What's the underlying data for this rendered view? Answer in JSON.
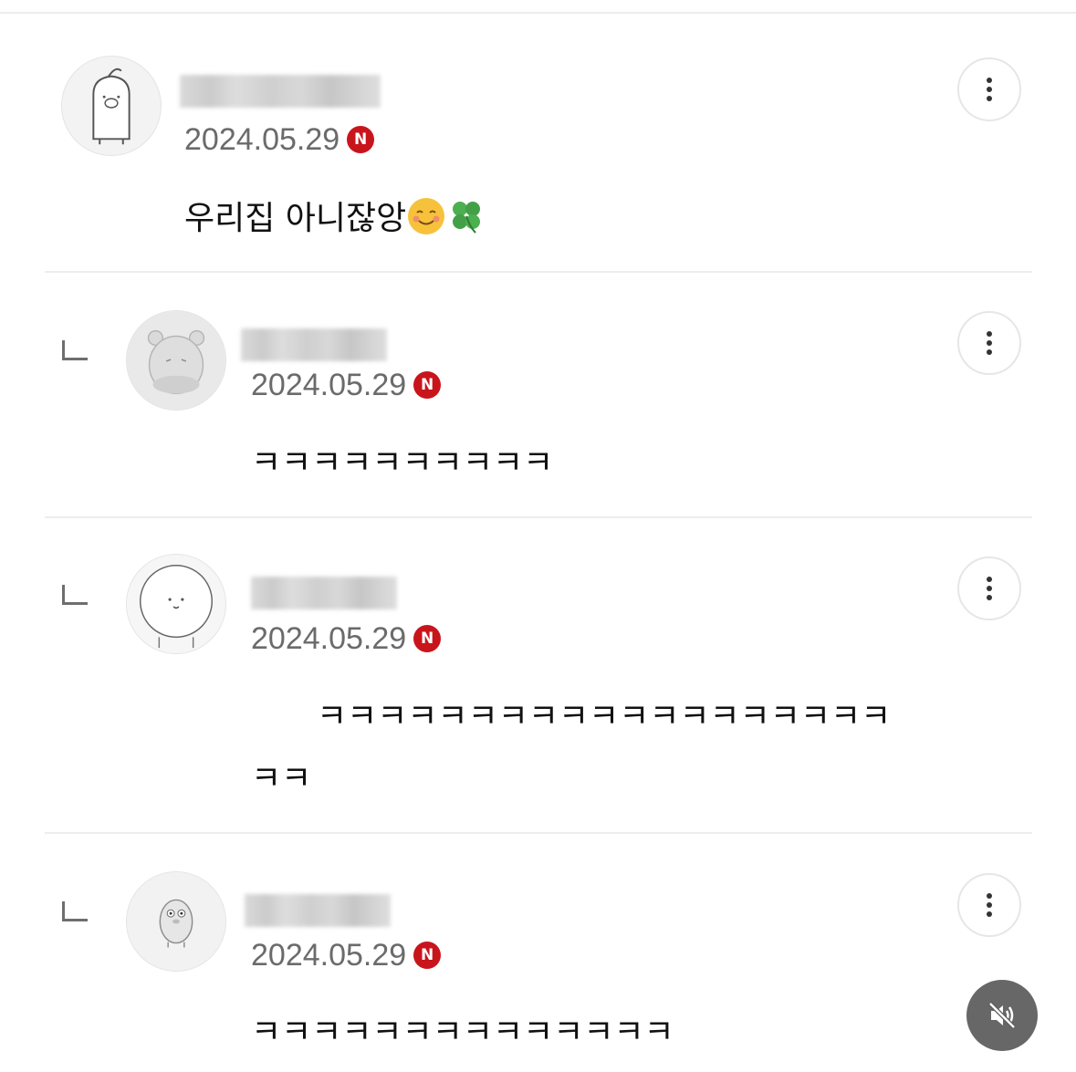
{
  "comments": [
    {
      "is_reply": false,
      "date": "2024.05.29",
      "badge": "N",
      "text": "우리집 아니잖앙",
      "emojis": [
        "smiling-blush-emoji",
        "four-leaf-clover-emoji"
      ]
    },
    {
      "is_reply": true,
      "date": "2024.05.29",
      "badge": "N",
      "text": "ㅋㅋㅋㅋㅋㅋㅋㅋㅋㅋ"
    },
    {
      "is_reply": true,
      "date": "2024.05.29",
      "badge": "N",
      "text_line1": "ㅋㅋㅋㅋㅋㅋㅋㅋㅋㅋㅋㅋㅋㅋㅋㅋㅋㅋㅋ",
      "text_line2": "ㅋㅋ"
    },
    {
      "is_reply": true,
      "date": "2024.05.29",
      "badge": "N",
      "text": "ㅋㅋㅋㅋㅋㅋㅋㅋㅋㅋㅋㅋㅋㅋ"
    }
  ],
  "icons": {
    "more": "more-vertical-icon",
    "mute": "speaker-muted-icon",
    "reply": "reply-corner-icon"
  },
  "colors": {
    "badge": "#c8151b",
    "date": "#6b6b6b",
    "divider": "#ededed"
  }
}
